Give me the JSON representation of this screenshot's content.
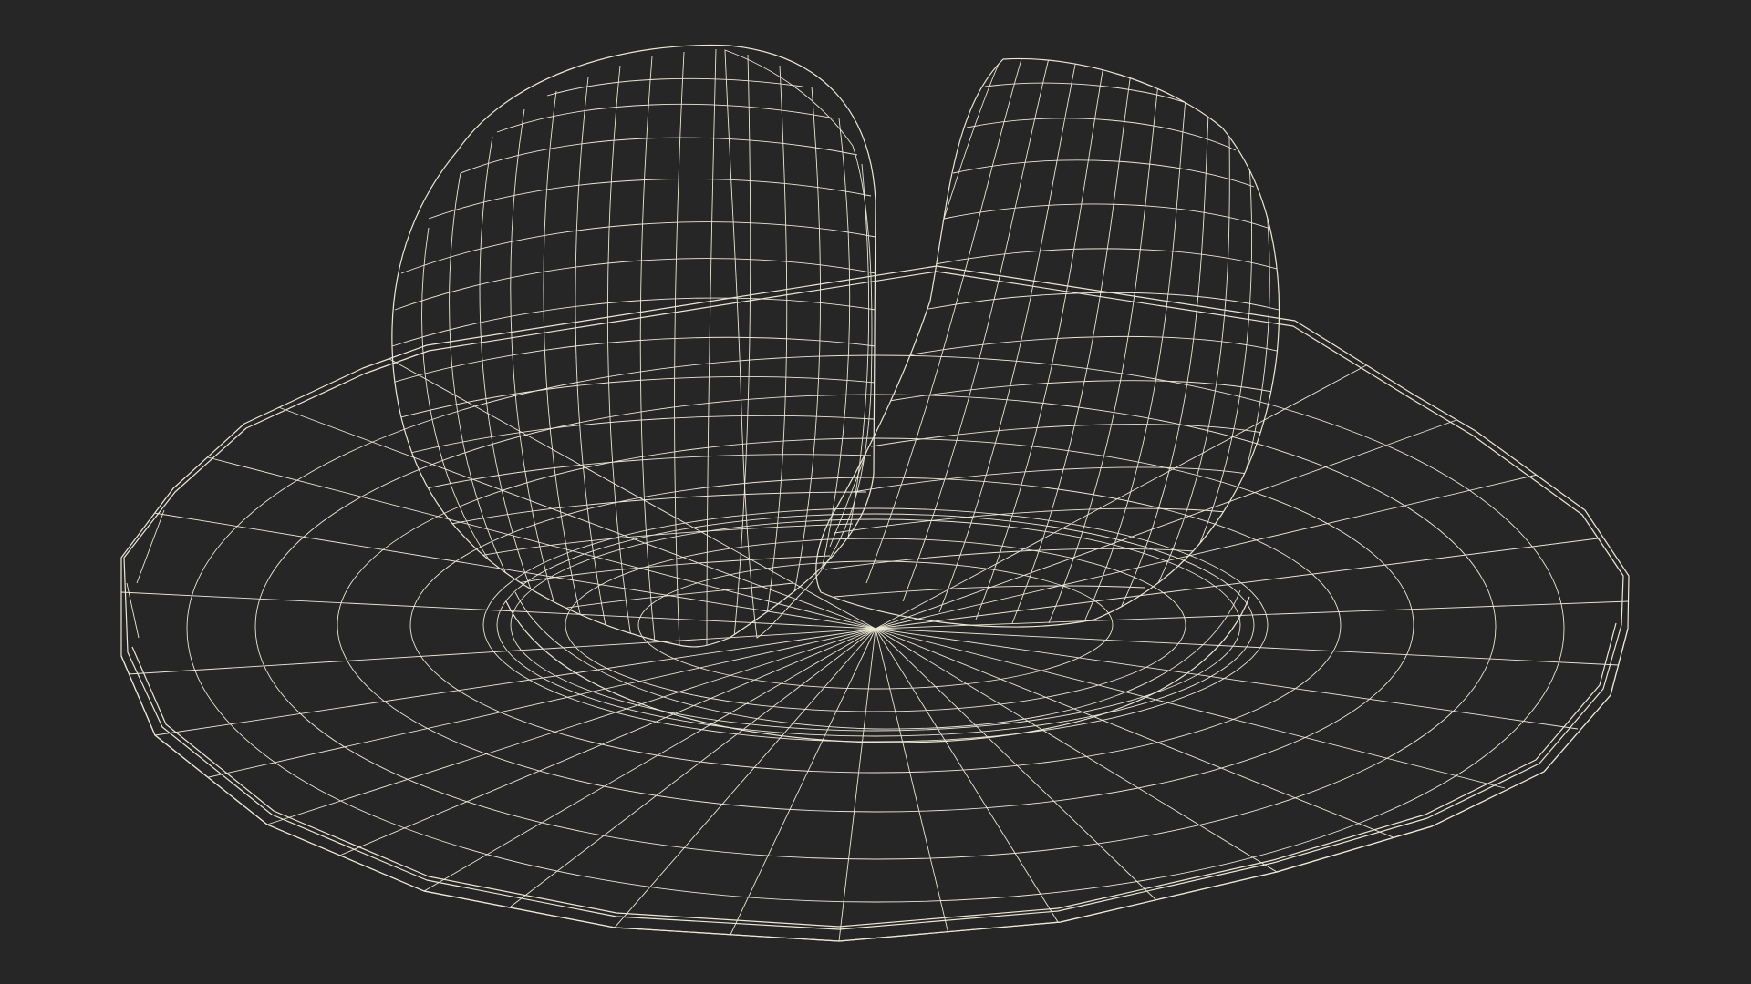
{
  "scene": {
    "background_color": "#262626",
    "surface_color": "#7f7f6c",
    "wire_color": "#ece8d6",
    "objects": [
      "plate",
      "left-fruit-half",
      "right-fruit-half"
    ]
  }
}
